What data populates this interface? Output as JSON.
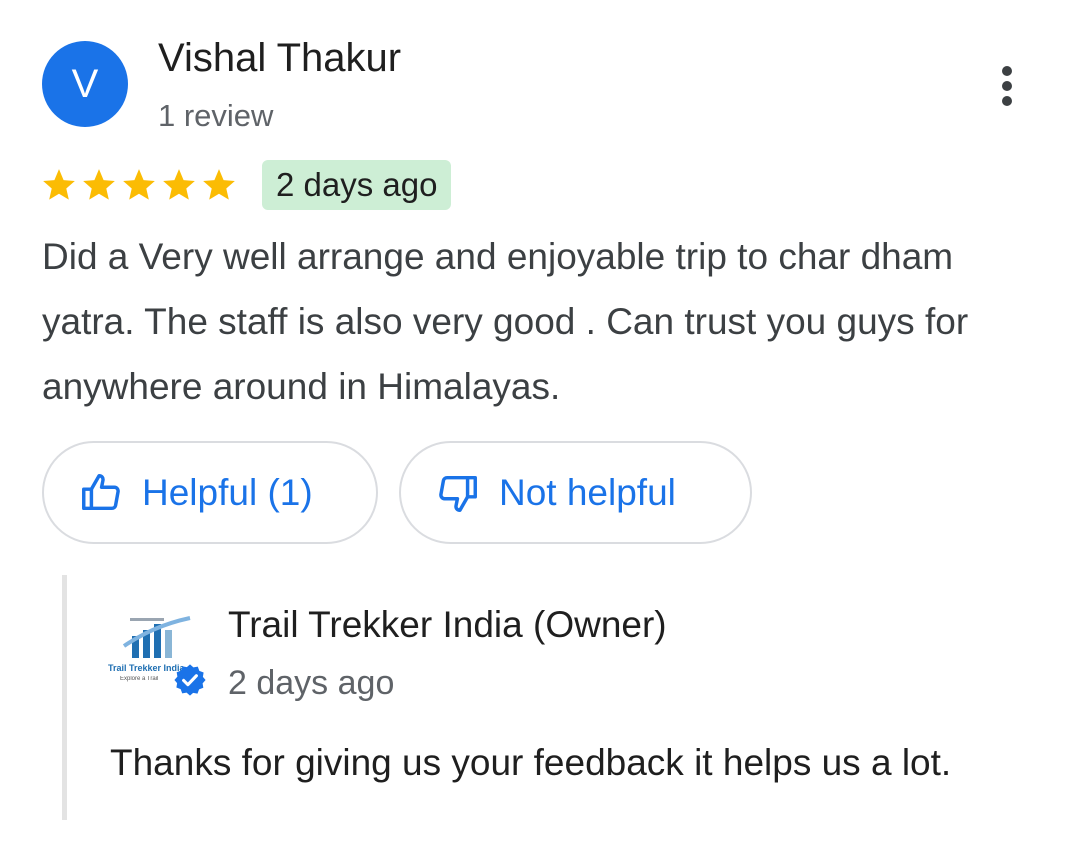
{
  "review": {
    "avatar_initial": "V",
    "reviewer_name": "Vishal Thakur",
    "review_count": "1 review",
    "rating": 5,
    "rating_max": 5,
    "time_ago": "2 days ago",
    "text": "Did a Very well arrange and enjoyable trip to char dham yatra. The staff is also very good . Can trust you guys for anywhere around in Himalayas.",
    "helpful_label": "Helpful (1)",
    "not_helpful_label": "Not helpful",
    "more_icon": "more-vert-icon"
  },
  "owner_reply": {
    "name": "Trail Trekker India (Owner)",
    "time_ago": "2 days ago",
    "text": "Thanks for giving us your feedback it helps us a lot.",
    "logo_text": "Trail Trekker India",
    "logo_tagline": "Explore a Trail",
    "verified_icon": "verified-badge-icon"
  },
  "colors": {
    "accent": "#1a73e8",
    "star": "#fbbc04",
    "time_badge_bg": "#cdeed5",
    "secondary_text": "#5f6368"
  }
}
